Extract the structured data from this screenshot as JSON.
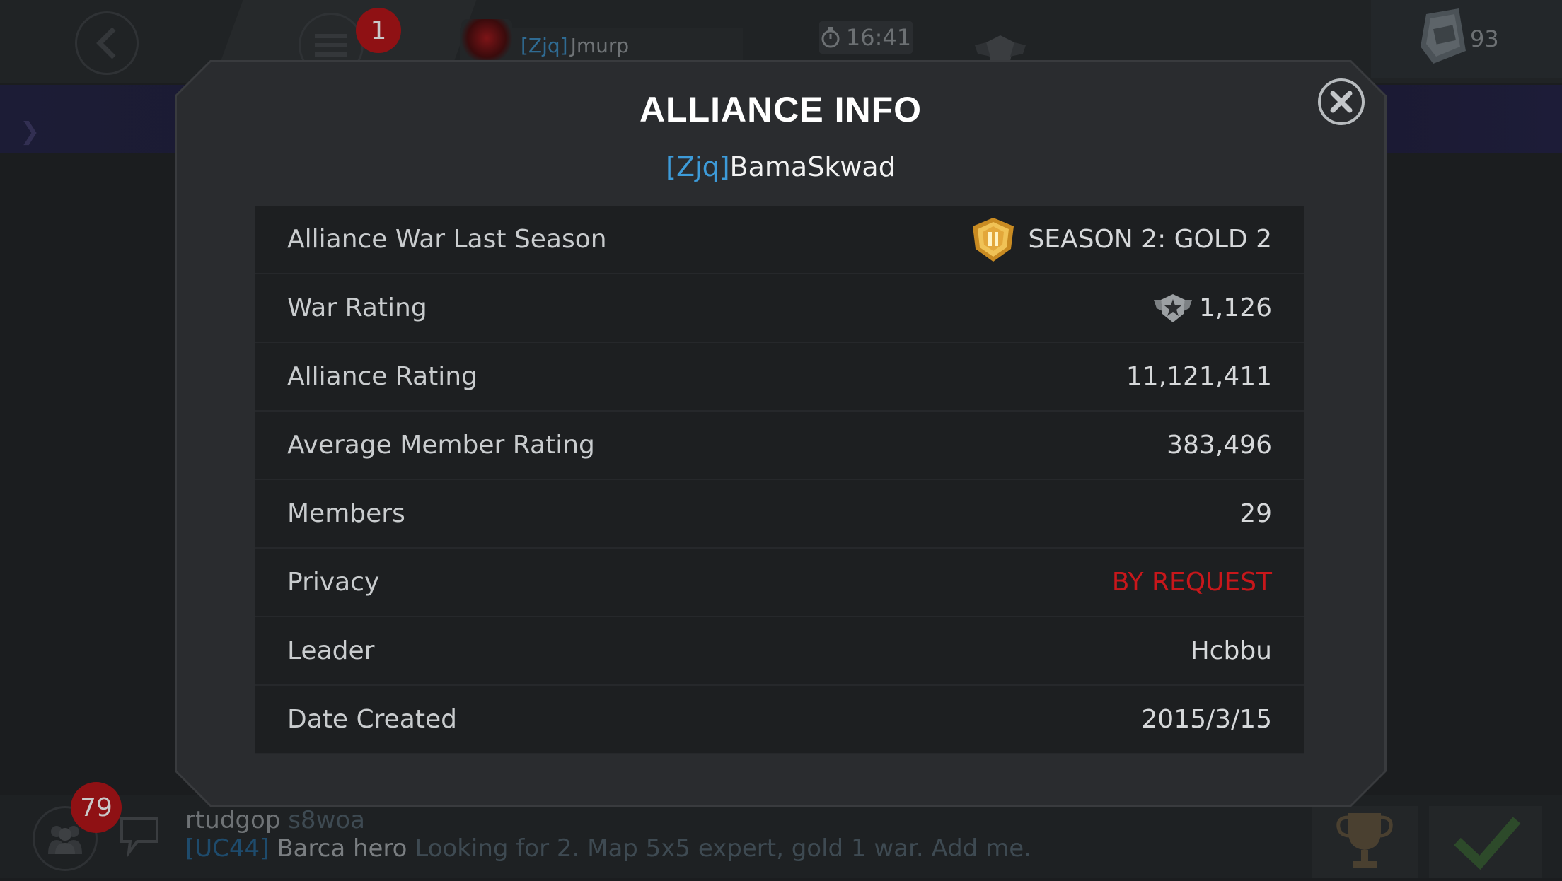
{
  "top_bar": {
    "notification_count": "1",
    "player": {
      "tag": "[Zjq]",
      "name": "Jmurp"
    },
    "timer": "16:41",
    "currency_value": "93"
  },
  "modal": {
    "title": "ALLIANCE INFO",
    "alliance_tag": "[Zjq]",
    "alliance_name": "BamaSkwad",
    "rows": [
      {
        "label": "Alliance War Last Season",
        "value": "SEASON 2: GOLD 2",
        "icon": "gold-tier-shield-icon"
      },
      {
        "label": "War Rating",
        "value": "1,126",
        "icon": "war-rating-star-icon"
      },
      {
        "label": "Alliance Rating",
        "value": "11,121,411"
      },
      {
        "label": "Average Member Rating",
        "value": "383,496"
      },
      {
        "label": "Members",
        "value": "29"
      },
      {
        "label": "Privacy",
        "value": "BY REQUEST",
        "color": "#c8171b"
      },
      {
        "label": "Leader",
        "value": "Hcbbu"
      },
      {
        "label": "Date Created",
        "value": "2015/3/15"
      }
    ]
  },
  "bottom_bar": {
    "chat_badge_count": "79",
    "chat_line1": {
      "user": "rtudgop",
      "message": "s8woa"
    },
    "chat_line2": {
      "tag": "[UC44]",
      "user": "Barca hero",
      "message": "Looking for 2. Map 5x5 expert, gold 1 war. Add me."
    }
  },
  "colors": {
    "accent_blue": "#3d9bd9",
    "privacy_red": "#c8171b",
    "modal_bg": "#2a2c2f",
    "table_bg": "#1d1f21"
  }
}
